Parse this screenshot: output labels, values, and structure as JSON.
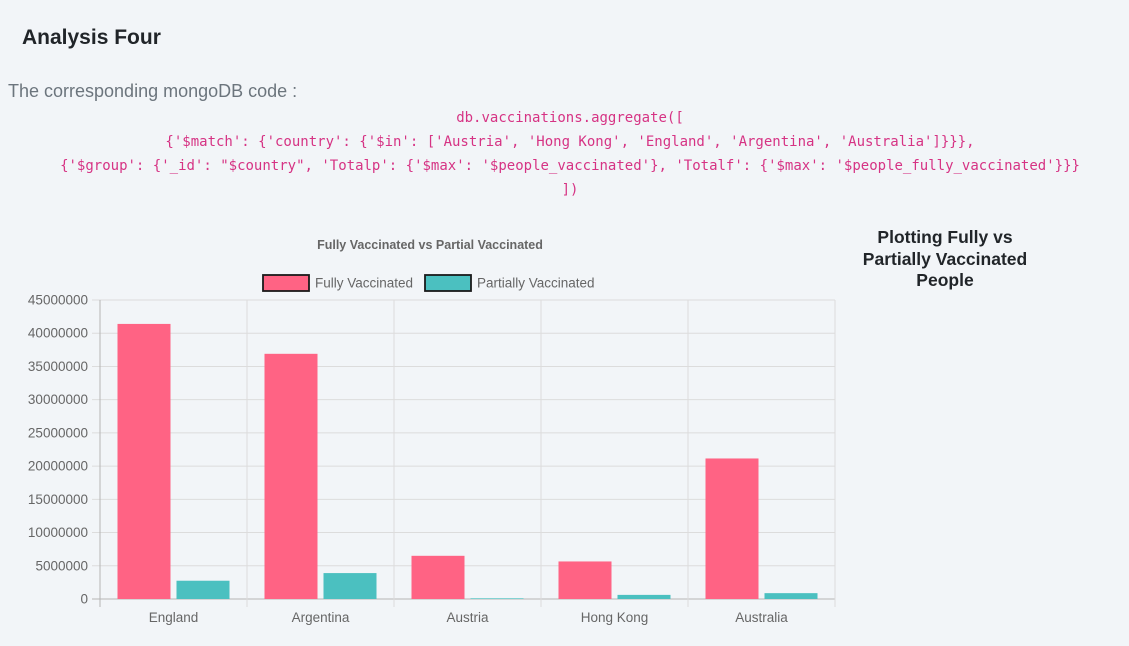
{
  "heading": "Analysis Four",
  "intro": "The corresponding mongoDB code :",
  "code_lines": [
    "db.vaccinations.aggregate([",
    "{'$match': {'country': {'$in': ['Austria', 'Hong Kong', 'England', 'Argentina', 'Australia']}}},",
    "{'$group': {'_id': \"$country\", 'Totalp': {'$max': '$people_vaccinated'}, 'Totalf': {'$max': '$people_fully_vaccinated'}}}",
    "])"
  ],
  "side_title": "Plotting Fully vs Partially Vaccinated People",
  "colors": {
    "fully": "#ff6384",
    "partially": "#4bc0c0",
    "code": "#d63384"
  },
  "chart_data": {
    "type": "bar",
    "title": "Fully Vaccinated vs Partial Vaccinated",
    "categories": [
      "England",
      "Argentina",
      "Austria",
      "Hong Kong",
      "Australia"
    ],
    "series": [
      {
        "name": "Fully Vaccinated",
        "values": [
          41400000,
          36900000,
          6500000,
          5650000,
          21150000
        ]
      },
      {
        "name": "Partially Vaccinated",
        "values": [
          2750000,
          3900000,
          100000,
          620000,
          880000
        ]
      }
    ],
    "ylim": [
      0,
      45000000
    ],
    "yticks": [
      0,
      5000000,
      10000000,
      15000000,
      20000000,
      25000000,
      30000000,
      35000000,
      40000000,
      45000000
    ],
    "legend": "top",
    "grid": true
  }
}
